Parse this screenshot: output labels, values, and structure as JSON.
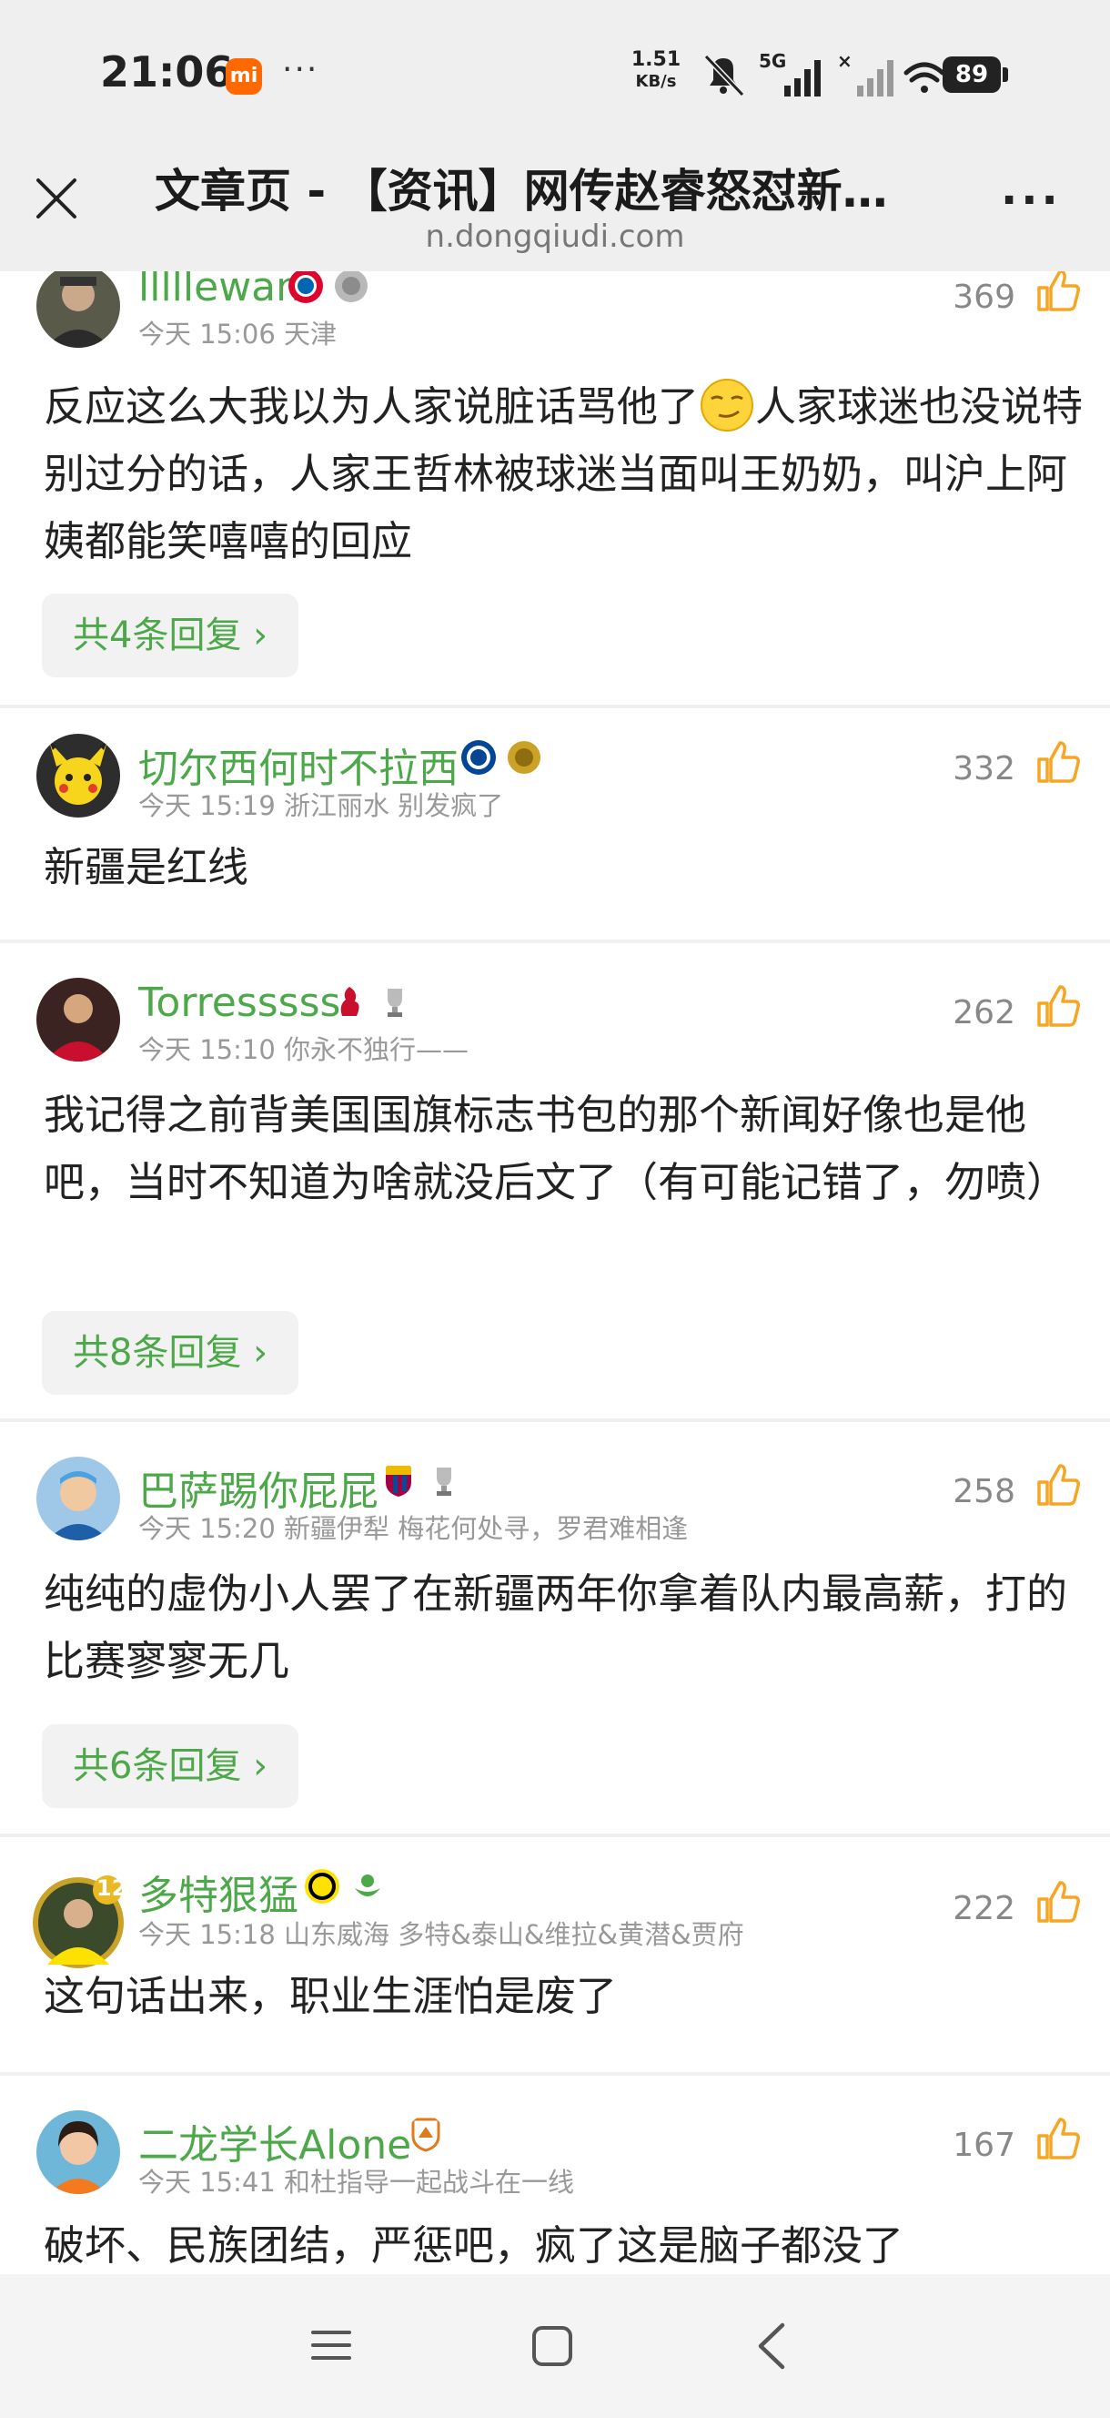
{
  "status_bar": {
    "time": "21:06",
    "brand_badge": "mi",
    "more": "···",
    "net_speed_value": "1.51",
    "net_speed_unit": "KB/s",
    "network": "5G",
    "battery": "89"
  },
  "title_bar": {
    "title": "文章页 - 【资讯】网传赵睿怒怼新…",
    "url": "n.dongqiudi.com",
    "more": "···"
  },
  "colors": {
    "username_green": "#4da84a",
    "like_orange": "#f5a623",
    "meta_gray": "#999999"
  },
  "comments": [
    {
      "username": "lllllewan",
      "badges": [
        "bayern-badge",
        "silver-medal-badge"
      ],
      "meta": "今天 15:06 天津",
      "likes": "369",
      "text_before_emoji": "反应这么大我以为人家说脏话骂他了",
      "emoji": "smirk-emoji",
      "text": "人家球迷也没说特别过分的话，人家王哲林被球迷当面叫王奶奶，叫沪上阿姨都能笑嘻嘻的回应",
      "replies": "共4条回复"
    },
    {
      "username": "切尔西何时不拉西",
      "badges": [
        "chelsea-badge",
        "gold-medal-badge"
      ],
      "meta": "今天 15:19 浙江丽水 别发疯了",
      "likes": "332",
      "text": "新疆是红线"
    },
    {
      "username": "Torresssss",
      "badges": [
        "liverpool-badge",
        "trophy-badge"
      ],
      "meta": "今天 15:10 你永不独行——",
      "likes": "262",
      "text": "我记得之前背美国国旗标志书包的那个新闻好像也是他吧，当时不知道为啥就没后文了（有可能记错了，勿喷）",
      "replies": "共8条回复"
    },
    {
      "username": "巴萨踢你屁屁",
      "badges": [
        "barcelona-badge",
        "trophy-badge"
      ],
      "meta": "今天 15:20 新疆伊犁 梅花何处寻，罗君难相逢",
      "likes": "258",
      "text": "纯纯的虚伪小人罢了在新疆两年你拿着队内最高薪，打的比赛寥寥无几",
      "replies": "共6条回复"
    },
    {
      "username": "多特狠猛",
      "avatar_level": "12",
      "badges": [
        "dortmund-badge",
        "green-emblem-badge"
      ],
      "meta": "今天 15:18 山东威海 多特&泰山&维拉&黄潜&贾府",
      "likes": "222",
      "text": "这句话出来，职业生涯怕是废了"
    },
    {
      "username": "二龙学长Alone",
      "badges": [
        "shandong-taishan-badge"
      ],
      "meta": "今天 15:41 和杜指导一起战斗在一线",
      "likes": "167",
      "text": "破坏、民族团结，严惩吧，疯了这是脑子都没了"
    }
  ],
  "nav_bar": {
    "items": [
      "menu",
      "home",
      "back"
    ]
  }
}
